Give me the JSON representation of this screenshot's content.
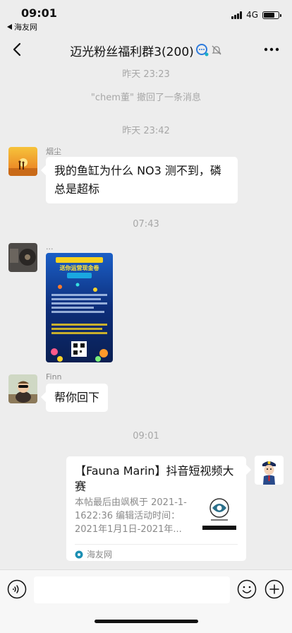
{
  "status": {
    "time": "09:01",
    "back_app": "海友网",
    "network": "4G",
    "battery_level": 0.75
  },
  "header": {
    "title": "迈光粉丝福利群3(200)",
    "back_icon": "chevron-left-icon",
    "more_icon": "more-dots-icon"
  },
  "messages": [
    {
      "type": "time",
      "text": "昨天 23:23"
    },
    {
      "type": "system",
      "text": "\"chem董\" 撤回了一条消息"
    },
    {
      "type": "time",
      "text": "昨天 23:42"
    },
    {
      "type": "text",
      "sender": "烟尘",
      "text": "我的鱼缸为什么 NO3 测不到，磷总是超标"
    },
    {
      "type": "time",
      "text": "07:43"
    },
    {
      "type": "image",
      "sender": "...",
      "poster_title": "送你运营现金卷"
    },
    {
      "type": "text",
      "sender": "Finn",
      "text": "帮你回下"
    },
    {
      "type": "time",
      "text": "09:01"
    },
    {
      "type": "link",
      "title": "【Fauna Marin】抖音短视频大赛",
      "desc": "本帖最后由飒枫于 2021-1-1622:36 编辑活动时间：2021年1月1日-2021年...",
      "source": "海友网"
    }
  ],
  "input": {
    "placeholder": ""
  },
  "colors": {
    "background": "#ededed",
    "bubble": "#ffffff",
    "muted": "#a7a7a7"
  }
}
